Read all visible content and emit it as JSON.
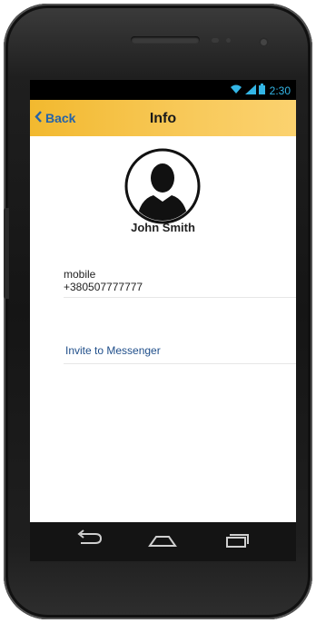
{
  "status": {
    "time": "2:30"
  },
  "header": {
    "back_label": "Back",
    "title": "Info"
  },
  "contact": {
    "name": "John Smith",
    "phone_label": "mobile",
    "phone_value": "+380507777777"
  },
  "actions": {
    "invite_label": "Invite to Messenger"
  },
  "colors": {
    "header_start": "#f2b92f",
    "header_end": "#fbd26f",
    "link_blue": "#1f4e8a",
    "status_blue": "#33b5e5"
  },
  "icons": {
    "wifi": "wifi-icon",
    "signal": "signal-icon",
    "battery": "battery-icon",
    "back_nav": "back-nav-icon",
    "home": "home-icon",
    "recents": "recent-apps-icon",
    "avatar": "avatar-icon"
  }
}
